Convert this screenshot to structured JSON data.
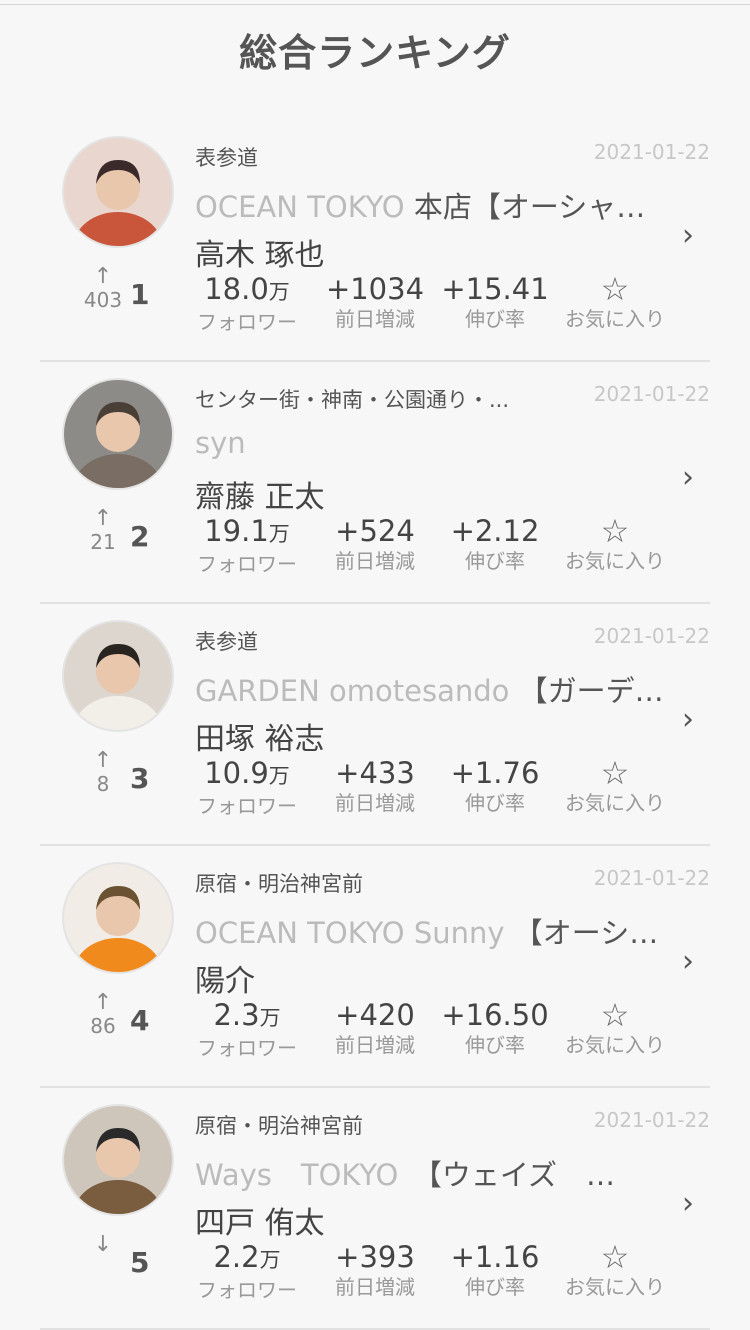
{
  "header": {
    "title": "総合ランキング"
  },
  "labels": {
    "followers": "フォロワー",
    "daily_change": "前日増減",
    "growth_rate": "伸び率",
    "favorite": "お気に入り",
    "chevron": "›",
    "fav_glyph": "☆"
  },
  "rankings": [
    {
      "rank": "1",
      "arrow": "↑",
      "rank_delta": "403",
      "area": "表参道",
      "date": "2021-01-22",
      "salon_en": "OCEAN TOKYO ",
      "salon_jp": "本店【オーシャ…",
      "name": "高木 琢也",
      "followers": "18.0",
      "followers_unit": "万",
      "daily_change": "+1034",
      "growth_rate": "+15.41"
    },
    {
      "rank": "2",
      "arrow": "↑",
      "rank_delta": "21",
      "area": "センター街・神南・公園通り・...",
      "date": "2021-01-22",
      "salon_en": "syn",
      "salon_jp": "",
      "name": "齋藤 正太",
      "followers": "19.1",
      "followers_unit": "万",
      "daily_change": "+524",
      "growth_rate": "+2.12"
    },
    {
      "rank": "3",
      "arrow": "↑",
      "rank_delta": "8",
      "area": "表参道",
      "date": "2021-01-22",
      "salon_en": "GARDEN omotesando ",
      "salon_jp": "【ガーデ…",
      "name": "田塚 裕志",
      "followers": "10.9",
      "followers_unit": "万",
      "daily_change": "+433",
      "growth_rate": "+1.76"
    },
    {
      "rank": "4",
      "arrow": "↑",
      "rank_delta": "86",
      "area": "原宿・明治神宮前",
      "date": "2021-01-22",
      "salon_en": "OCEAN TOKYO Sunny ",
      "salon_jp": "【オーシ…",
      "name": "陽介",
      "followers": "2.3",
      "followers_unit": "万",
      "daily_change": "+420",
      "growth_rate": "+16.50"
    },
    {
      "rank": "5",
      "arrow": "↓",
      "rank_delta": "",
      "area": "原宿・明治神宮前",
      "date": "2021-01-22",
      "salon_en": "Ways　TOKYO　",
      "salon_jp": "【ウェイズ　…",
      "name": "四戸 侑太",
      "followers": "2.2",
      "followers_unit": "万",
      "daily_change": "+393",
      "growth_rate": "+1.16"
    }
  ]
}
